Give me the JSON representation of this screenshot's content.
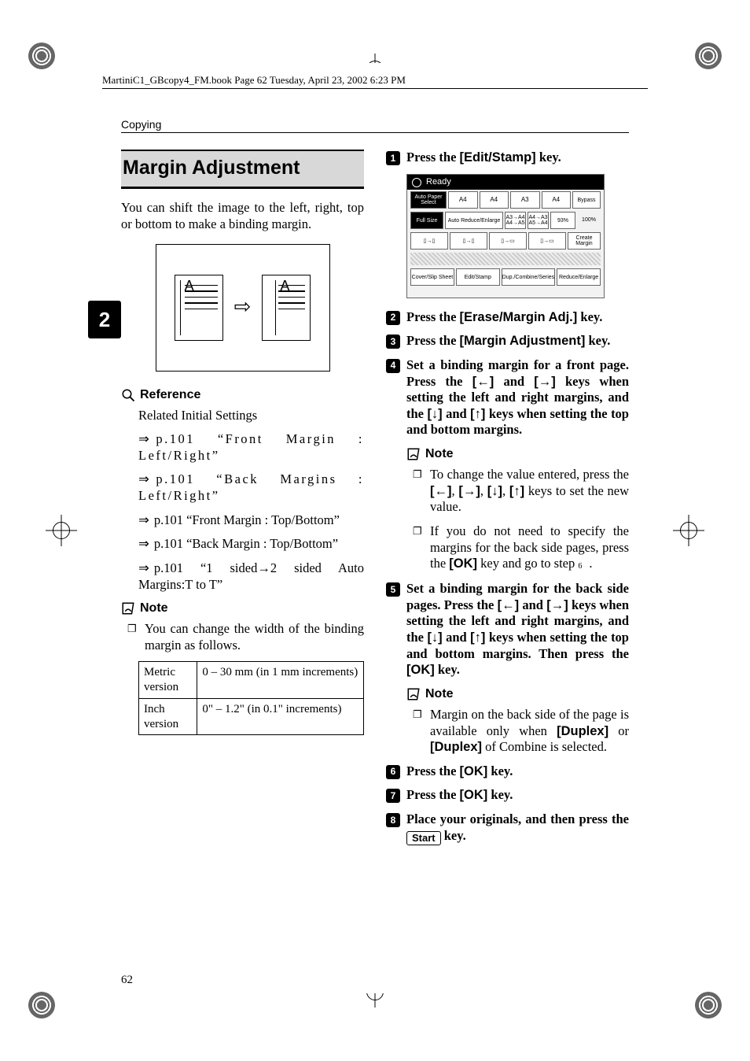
{
  "meta": {
    "running_head": "MartiniC1_GBcopy4_FM.book  Page 62  Tuesday, April 23, 2002  6:23 PM",
    "category": "Copying",
    "side_tab": "2",
    "page_number": "62"
  },
  "left": {
    "title": "Margin Adjustment",
    "intro": "You can shift the image to the left, right, top or bottom to make a binding margin.",
    "diagram_letter": "A",
    "reference": {
      "heading": "Reference",
      "lead": "Related Initial Settings",
      "items": [
        "p.101 “Front Margin : Left/Right”",
        "p.101 “Back Margins : Left/Right”",
        "p.101 “Front Margin : Top/Bottom”",
        "p.101 “Back Margin : Top/Bottom”",
        "p.101 “1 sided→2 sided Auto Margins:T to T”"
      ]
    },
    "note": {
      "heading": "Note",
      "item": "You can change the width of the binding margin as follows."
    },
    "table": {
      "r1c1": "Metric version",
      "r1c2": "0 – 30 mm (in 1 mm increments)",
      "r2c1": "Inch version",
      "r2c2": "0\" – 1.2\" (in 0.1\" increments)"
    }
  },
  "right": {
    "screenshot": {
      "ready": "Ready",
      "auto_paper": "Auto Paper Select",
      "trays": [
        "A4",
        "A4",
        "A3",
        "A4"
      ],
      "bypass": "Bypass",
      "full_size": "Full Size",
      "are": "Auto Reduce/Enlarge",
      "ratio_box1": "A3→A4 A4→A5",
      "ratio_box2": "A4→A3 A5→A4",
      "pct": "93%",
      "hundred": "100%",
      "create_margin": "Create Margin",
      "bottom": [
        "Cover/Slip Sheet",
        "Edit/Stamp",
        "Dup./Combine/Series",
        "Reduce/Enlarge"
      ]
    },
    "steps": {
      "s1_a": "Press the ",
      "s1_b": "[Edit/Stamp]",
      "s1_c": " key.",
      "s2_a": "Press the ",
      "s2_b": "[Erase/Margin Adj.]",
      "s2_c": " key.",
      "s3_a": "Press the ",
      "s3_b": "[Margin Adjustment]",
      "s3_c": " key.",
      "s4_a": "Set a binding margin for a front page. Press the ",
      "s4_b": "[←]",
      "s4_c": " and ",
      "s4_d": "[→]",
      "s4_e": " keys when setting the left and right margins, and the ",
      "s4_f": "[↓]",
      "s4_g": " and ",
      "s4_h": "[↑]",
      "s4_i": " keys when setting the top and bottom margins.",
      "s5_a": "Set a binding margin for the back side pages. Press the ",
      "s5_b": "[←]",
      "s5_c": " and ",
      "s5_d": "[→]",
      "s5_e": " keys when setting the left and right margins, and the ",
      "s5_f": "[↓]",
      "s5_g": " and ",
      "s5_h": "[↑]",
      "s5_i": " keys when setting the top and bottom margins. Then press the ",
      "s5_j": "[OK]",
      "s5_k": " key.",
      "s6_a": "Press the ",
      "s6_b": "[OK]",
      "s6_c": " key.",
      "s7_a": "Press the ",
      "s7_b": "[OK]",
      "s7_c": " key.",
      "s8_a": "Place your originals, and then press the ",
      "s8_b": "Start",
      "s8_c": " key."
    },
    "note4": {
      "heading": "Note",
      "i1_a": "To change the value entered, press the ",
      "i1_b": "[←]",
      "i1_c": ", ",
      "i1_d": "[→]",
      "i1_e": ", ",
      "i1_f": "[↓]",
      "i1_g": ", ",
      "i1_h": "[↑]",
      "i1_i": " keys to set the new value.",
      "i2_a": "If you do not need to specify the margins for the back side pages, press the ",
      "i2_b": "[OK]",
      "i2_c": " key and go to step ",
      "i2_d": "."
    },
    "note5": {
      "heading": "Note",
      "i1_a": "Margin on the back side of the page is available only when ",
      "i1_b": "[Duplex]",
      "i1_c": " or ",
      "i1_d": "[Duplex]",
      "i1_e": " of Combine is selected."
    },
    "step_labels": {
      "n1": "1",
      "n2": "2",
      "n3": "3",
      "n4": "4",
      "n5": "5",
      "n6": "6",
      "n7": "7",
      "n8": "8"
    },
    "step6_ref": "6"
  }
}
